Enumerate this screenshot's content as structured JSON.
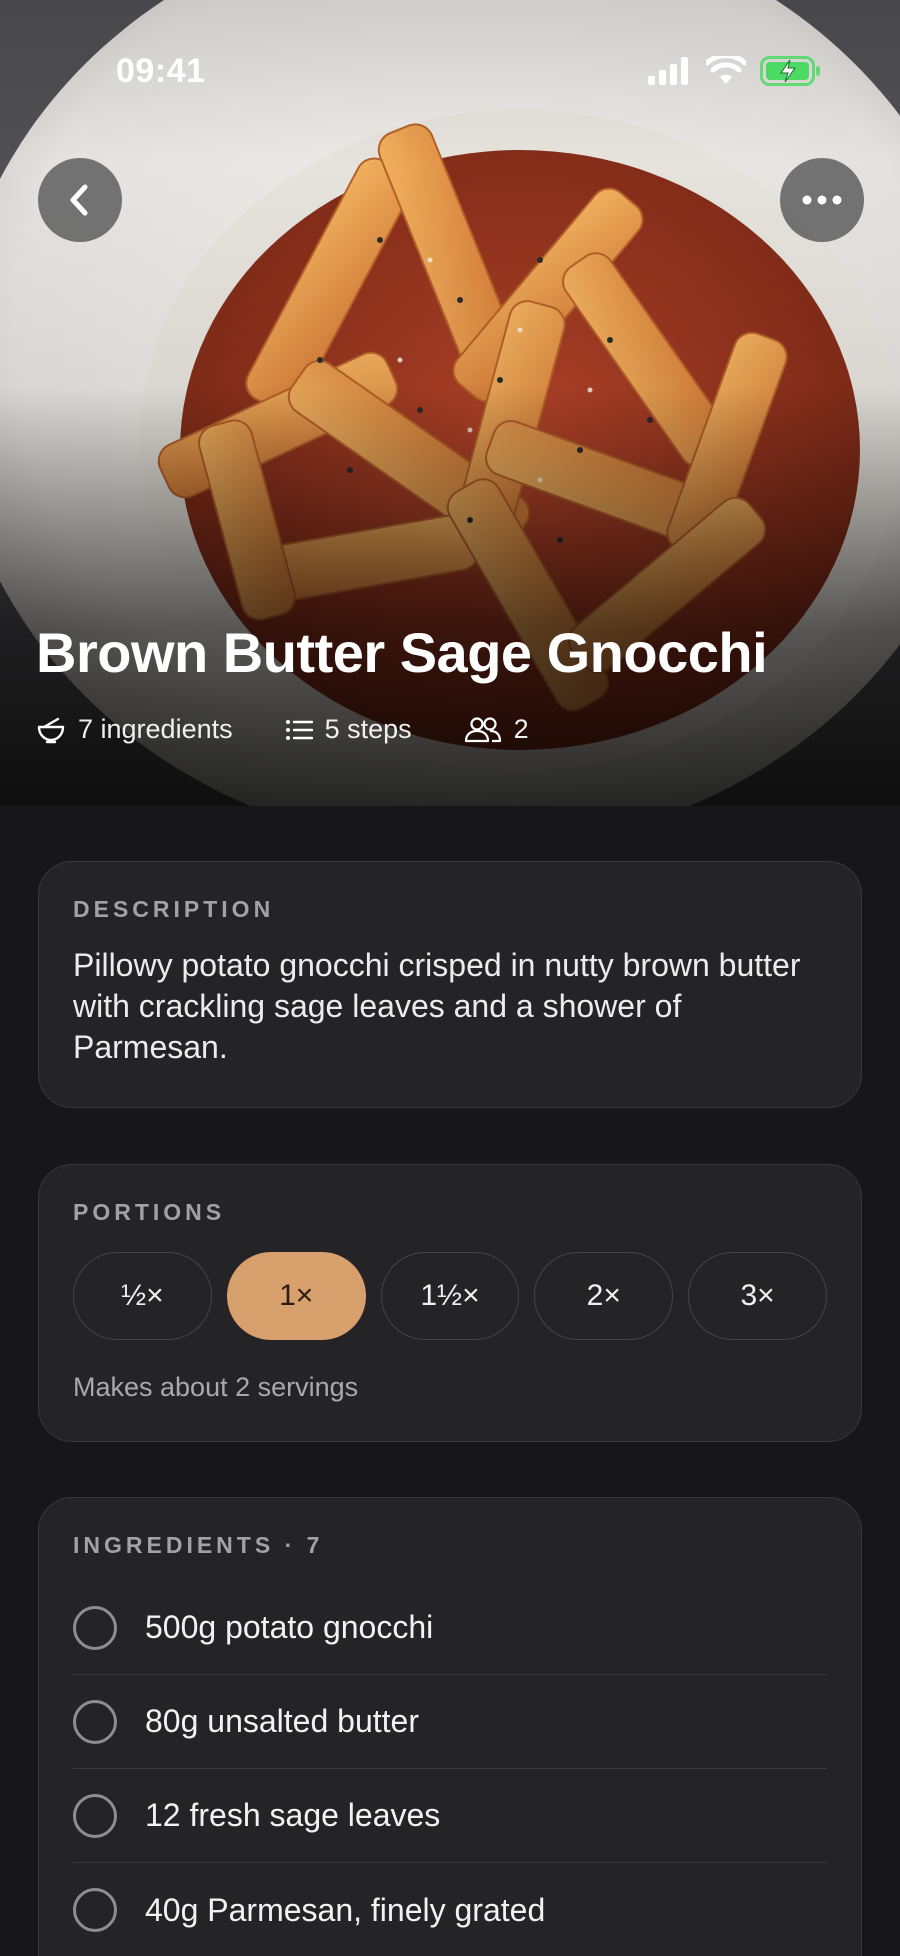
{
  "status": {
    "time": "09:41",
    "signal_icon": "cellular-signal-icon",
    "wifi_icon": "wifi-icon",
    "battery_icon": "battery-charging-icon",
    "battery_color": "#4cd964"
  },
  "nav": {
    "back_icon": "chevron-left-icon",
    "more_icon": "ellipsis-icon"
  },
  "recipe": {
    "title": "Brown Butter Sage Gnocchi",
    "meta": {
      "ingredients": "7 ingredients",
      "steps": "5 steps",
      "servings": "2"
    }
  },
  "description": {
    "label": "DESCRIPTION",
    "text": "Pillowy potato gnocchi crisped in nutty brown butter with crackling sage leaves and a shower of Parmesan."
  },
  "portions": {
    "label": "PORTIONS",
    "options": [
      "½×",
      "1×",
      "1½×",
      "2×",
      "3×"
    ],
    "selected": "1×",
    "note": "Makes about 2 servings",
    "accent": "#d8a06c"
  },
  "ingredients": {
    "label": "INGREDIENTS · 7",
    "items": [
      "500g potato gnocchi",
      "80g unsalted butter",
      "12 fresh sage leaves",
      "40g Parmesan, finely grated"
    ]
  }
}
